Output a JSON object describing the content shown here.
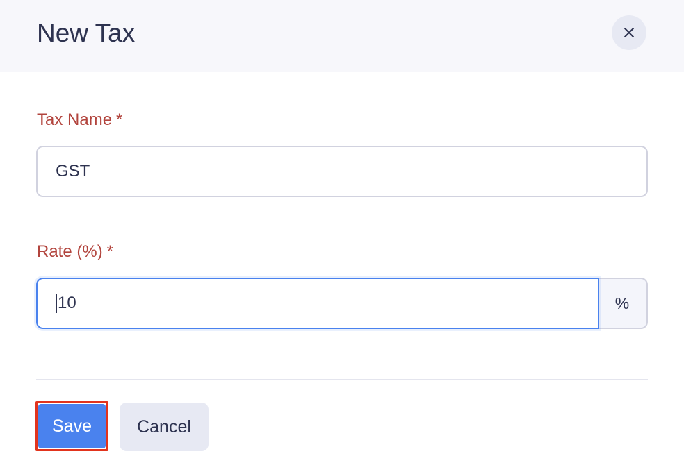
{
  "dialog": {
    "title": "New Tax",
    "close_icon": "close-icon"
  },
  "form": {
    "tax_name": {
      "label": "Tax Name",
      "required_mark": "*",
      "value": "GST"
    },
    "rate": {
      "label": "Rate (%)",
      "required_mark": "*",
      "value": "10",
      "addon": "%"
    }
  },
  "actions": {
    "save_label": "Save",
    "cancel_label": "Cancel"
  },
  "colors": {
    "accent": "#4a82ee",
    "label": "#b2443d",
    "highlight_outline": "#e2341d",
    "header_bg": "#f7f7fb"
  }
}
